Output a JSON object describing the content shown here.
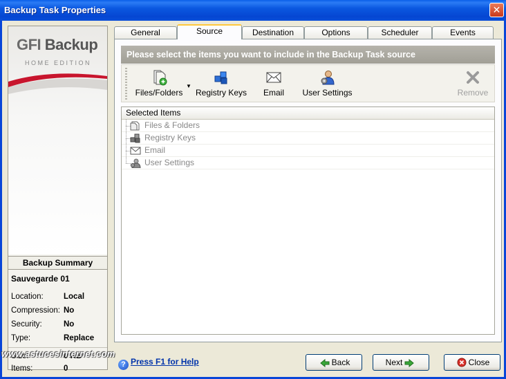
{
  "window": {
    "title": "Backup Task Properties",
    "close_icon": "close-icon"
  },
  "branding": {
    "logo_gfi": "GFI",
    "logo_backup": "Backup",
    "edition": "HOME EDITION"
  },
  "summary": {
    "title": "Backup Summary",
    "name": "Sauvegarde 01",
    "rows": [
      {
        "label": "Location:",
        "value": "Local"
      },
      {
        "label": "Compression:",
        "value": "No"
      },
      {
        "label": "Security:",
        "value": "No"
      },
      {
        "label": "Type:",
        "value": "Replace"
      },
      {
        "label": "Size:",
        "value": "0 KB"
      },
      {
        "label": "Items:",
        "value": "0"
      }
    ]
  },
  "tabs": [
    {
      "label": "General"
    },
    {
      "label": "Source",
      "active": true
    },
    {
      "label": "Destination"
    },
    {
      "label": "Options"
    },
    {
      "label": "Scheduler"
    },
    {
      "label": "Events"
    }
  ],
  "source": {
    "banner": "Please select the items you want to include in the Backup Task source",
    "toolbar": {
      "files_folders": "Files/Folders",
      "registry_keys": "Registry Keys",
      "email": "Email",
      "user_settings": "User Settings",
      "remove": "Remove"
    },
    "list_header": "Selected Items",
    "items": [
      {
        "label": "Files & Folders",
        "icon": "files-folders-icon"
      },
      {
        "label": "Registry Keys",
        "icon": "registry-keys-icon"
      },
      {
        "label": "Email",
        "icon": "email-icon"
      },
      {
        "label": "User Settings",
        "icon": "user-settings-icon"
      }
    ]
  },
  "footer": {
    "help": "Press F1 for Help",
    "back": "Back",
    "next": "Next",
    "close": "Close"
  },
  "watermark": "www.astucesinternet.com",
  "colors": {
    "title_bar": "#0a4fd8",
    "active_tab_accent": "#ffc83c",
    "help_link": "#0033aa",
    "close_red": "#c9381a"
  }
}
